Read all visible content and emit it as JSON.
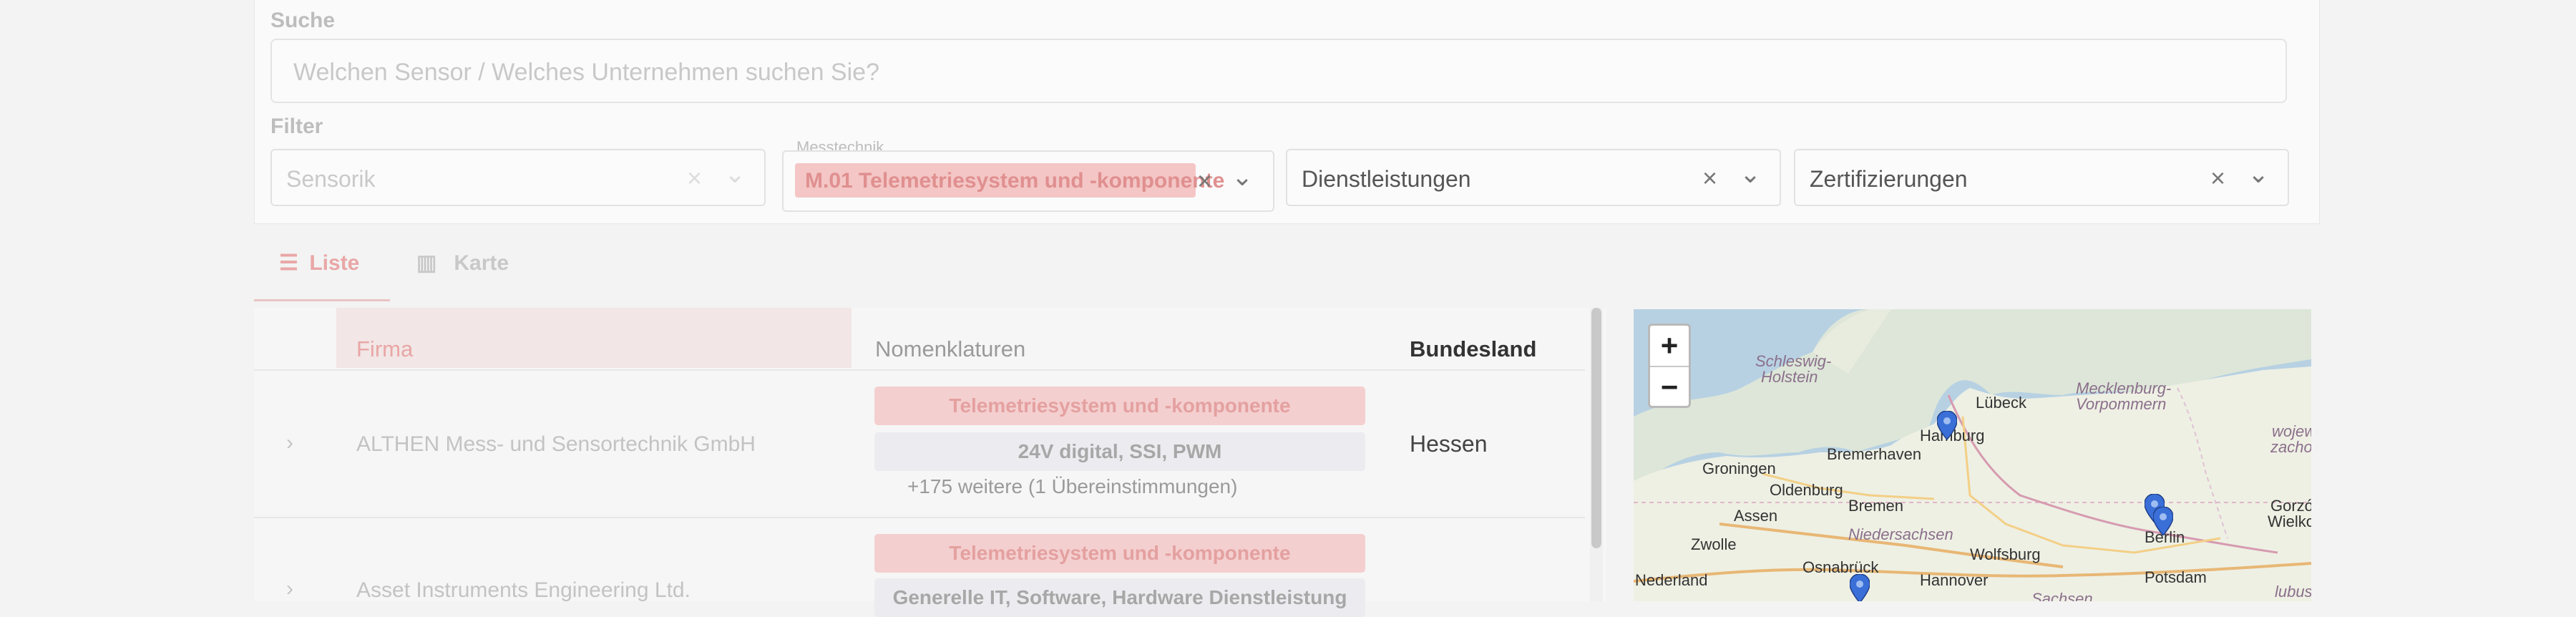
{
  "search": {
    "label": "Suche",
    "placeholder": "Welchen Sensor / Welches Unternehmen suchen Sie?"
  },
  "filter": {
    "label": "Filter",
    "sensorik": {
      "value": "Sensorik"
    },
    "messtechnik": {
      "label": "Messtechnik",
      "tag": "M.01 Telemetriesystem und -komponente"
    },
    "dienstleistungen": {
      "value": "Dienstleistungen"
    },
    "zertifizierungen": {
      "value": "Zertifizierungen"
    },
    "clear_symbol": "×",
    "chevron_symbol": "⌄"
  },
  "tabs": [
    {
      "label": "Liste",
      "icon": "list-icon"
    },
    {
      "label": "Karte",
      "icon": "map-icon"
    }
  ],
  "table": {
    "headers": {
      "firma": "Firma",
      "nomenklaturen": "Nomenklaturen",
      "bundesland": "Bundesland"
    },
    "rows": [
      {
        "firma": "ALTHEN Mess- und Sensortechnik GmbH",
        "pill_primary": "Telemetriesystem und -komponente",
        "pill_secondary": "24V digital, SSI, PWM",
        "more": "+175 weitere (1 Übereinstimmungen)",
        "bundesland": "Hessen"
      },
      {
        "firma": "Asset Instruments Engineering Ltd.",
        "pill_primary": "Telemetriesystem und -komponente",
        "pill_secondary": "Generelle IT, Software, Hardware Dienstleistung",
        "more": "",
        "bundesland": ""
      }
    ]
  },
  "map": {
    "zoom_in": "+",
    "zoom_out": "−",
    "places": {
      "schleswig": "Schleswig-",
      "holstein": "Holstein",
      "luebeck": "Lübeck",
      "mecklenburg": "Mecklenburg-",
      "vorpommern": "Vorpommern",
      "hamburg": "Hamburg",
      "bremerhaven": "Bremerhaven",
      "groningen": "Groningen",
      "oldenburg": "Oldenburg",
      "bremen": "Bremen",
      "assen": "Assen",
      "niedersachsen": "Niedersachsen",
      "zwolle": "Zwolle",
      "wolfsburg": "Wolfsburg",
      "osnabrueck": "Osnabrück",
      "hannover": "Hannover",
      "nederland": "Nederland",
      "berlin": "Berlin",
      "potsdam": "Potsdam",
      "sachsen": "Sachsen",
      "gorzow": "Gorzów",
      "wielkopolsk": "Wielkopols",
      "zachodniop": "zachodniop",
      "wojewod": "wojewódz",
      "lubuskie": "lubuskie"
    }
  }
}
